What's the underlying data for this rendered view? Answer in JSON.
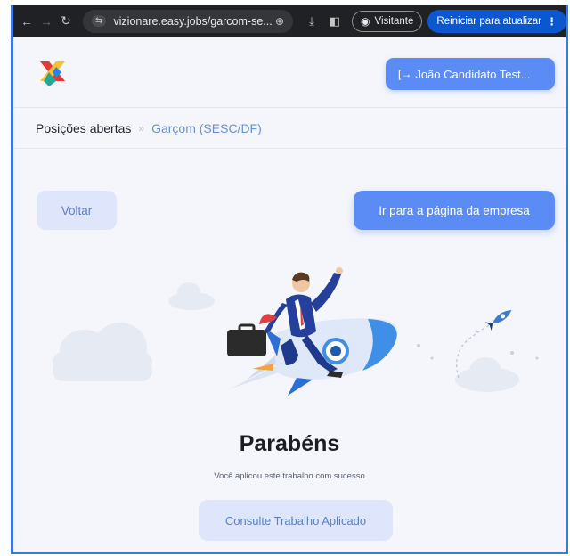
{
  "browser": {
    "url": "vizionare.easy.jobs/garcom-se...",
    "profile_label": "Visitante",
    "update_label": "Reiniciar para atualizar"
  },
  "header": {
    "user_button_label": "João Candidato Test..."
  },
  "breadcrumb": {
    "parent": "Posições abertas",
    "separator": "»",
    "current": "Garçom (SESC/DF)"
  },
  "actions": {
    "back_label": "Voltar",
    "company_label": "Ir para a página da empresa"
  },
  "success": {
    "title": "Parabéns",
    "message": "Você aplicou este trabalho com sucesso",
    "applied_button_label": "Consulte Trabalho Aplicado"
  },
  "colors": {
    "primary": "#5b8cf5",
    "primary_soft": "#dfe6fb",
    "browser_update": "#0b57d0"
  }
}
